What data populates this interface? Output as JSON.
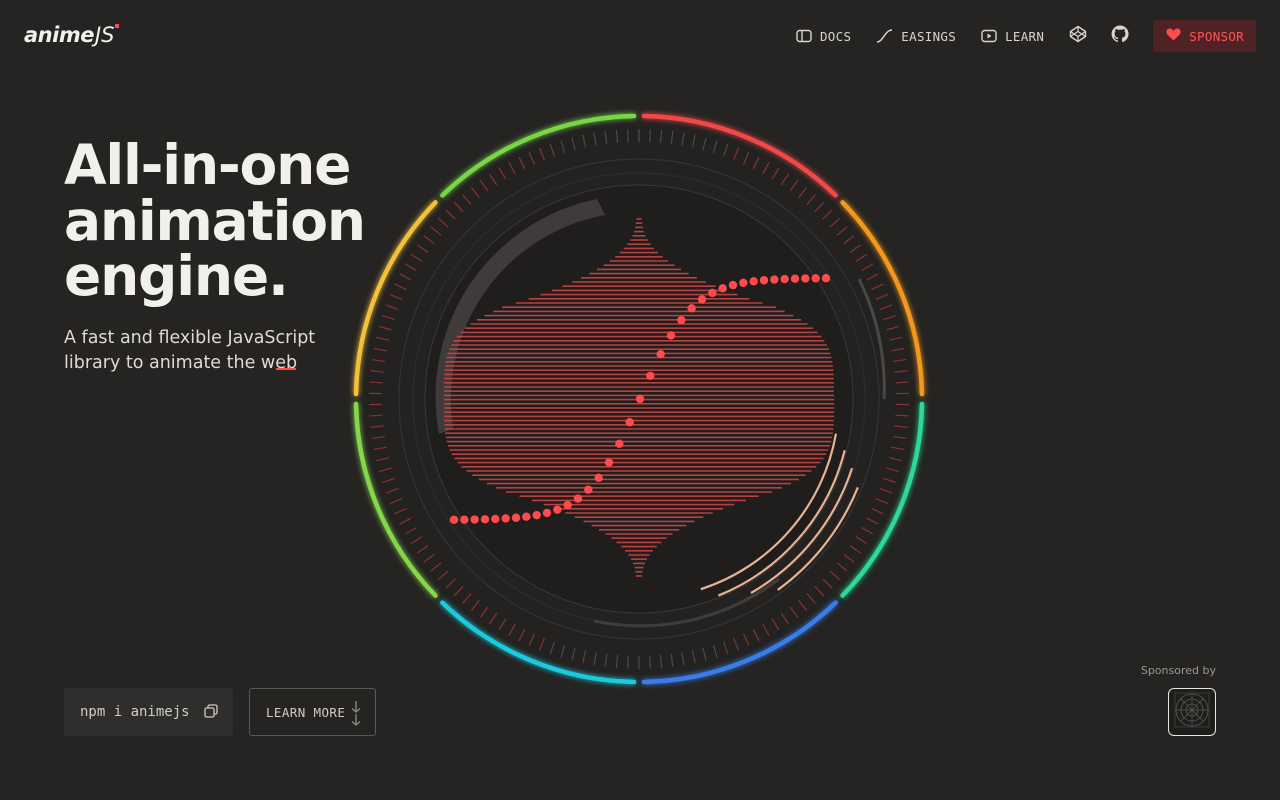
{
  "header": {
    "logo": {
      "word": "anime",
      "suffix": "JS"
    },
    "nav": [
      {
        "id": "docs",
        "label": "DOCS",
        "icon": "book-icon"
      },
      {
        "id": "easings",
        "label": "EASINGS",
        "icon": "easing-curve-icon"
      },
      {
        "id": "learn",
        "label": "LEARN",
        "icon": "play-icon"
      }
    ],
    "icon_links": [
      {
        "id": "codepen",
        "icon": "codepen-icon"
      },
      {
        "id": "github",
        "icon": "github-icon"
      }
    ],
    "sponsor": {
      "label": "SPONSOR",
      "icon": "heart-icon"
    }
  },
  "hero": {
    "title_lines": [
      "All-in-one",
      "animation",
      "engine."
    ],
    "subtitle_lines": [
      "A fast and flexible JavaScript",
      "library to animate the web"
    ]
  },
  "actions": {
    "install_command": "npm i animejs",
    "copy_icon": "copy-icon",
    "learn_more": "LEARN MORE",
    "learn_more_icon": "double-arrow-down-icon"
  },
  "sponsored": {
    "label": "Sponsored by",
    "logo_icon": "sponsor-grid-logo-icon"
  },
  "colors": {
    "background": "#252423",
    "accent_red": "#ff4b4b",
    "sponsor_bg": "#4f2326",
    "ring_gradient": [
      "#ff4b4b",
      "#ff9f1c",
      "#ffd23f",
      "#8be04e",
      "#3ee0a0",
      "#1fd3e8",
      "#3b82f6"
    ]
  }
}
